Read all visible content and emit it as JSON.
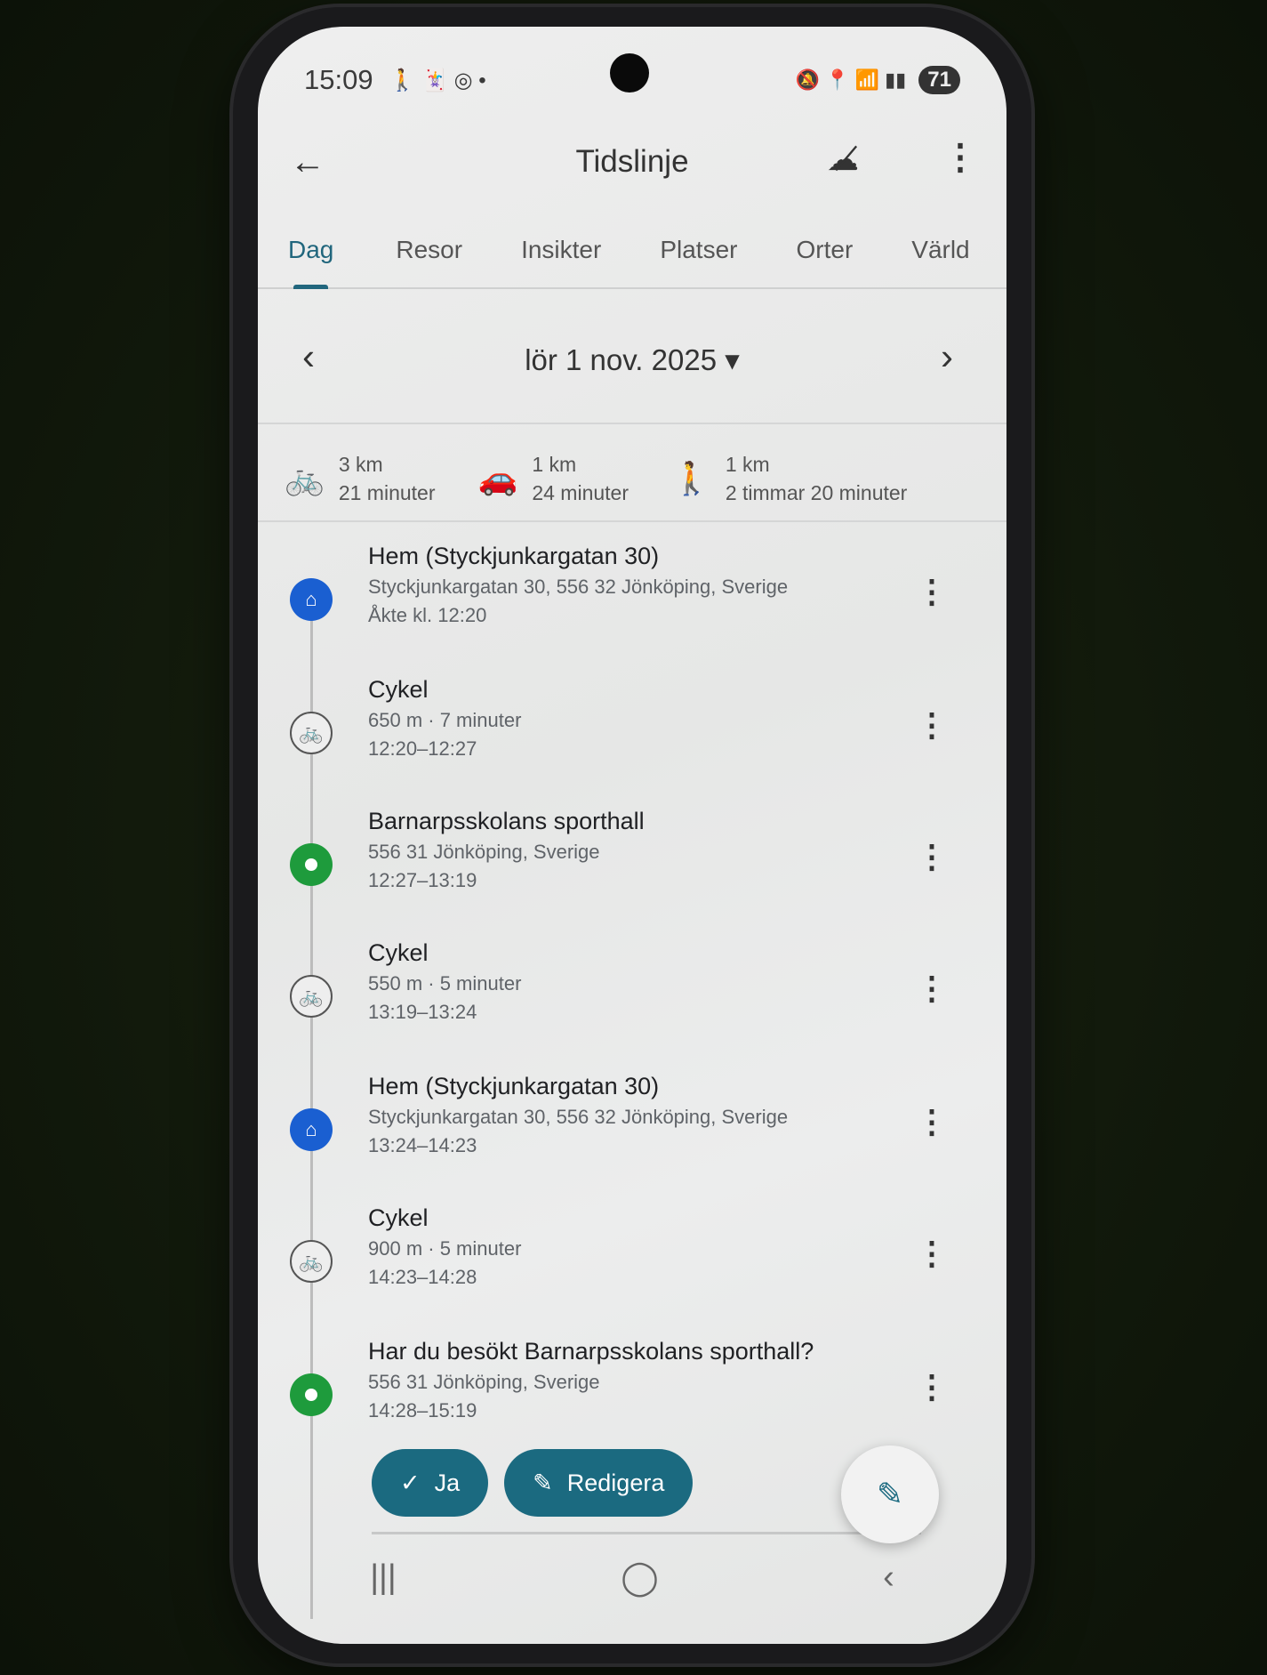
{
  "status": {
    "time": "15:09",
    "left_icons": "🚶 🃏 ◎ •",
    "right_icons": "🔕 📍 📶 ▮▮",
    "battery": "71"
  },
  "appbar": {
    "back_icon": "←",
    "title": "Tidslinje",
    "cloud_icon": "☁̸",
    "menu_icon": "⋮"
  },
  "tabs": [
    "Dag",
    "Resor",
    "Insikter",
    "Platser",
    "Orter",
    "Värld"
  ],
  "date_nav": {
    "prev": "‹",
    "date": "lör 1 nov. 2025 ▾",
    "next": "›"
  },
  "summary": [
    {
      "icon": "bike-icon",
      "glyph": "🚲",
      "distance": "3 km",
      "duration": "21 minuter"
    },
    {
      "icon": "car-icon",
      "glyph": "🚗",
      "distance": "1 km",
      "duration": "24 minuter"
    },
    {
      "icon": "walk-icon",
      "glyph": "🚶",
      "distance": "1 km",
      "duration": "2 timmar 20 minuter"
    }
  ],
  "entries": [
    {
      "type": "home",
      "title": "Hem (Styckjunkargatan 30)",
      "line1": "Styckjunkargatan 30, 556 32 Jönköping, Sverige",
      "line2": "Åkte kl. 12:20"
    },
    {
      "type": "bike",
      "title": "Cykel",
      "line1": "650 m · 7 minuter",
      "line2": "12:20–12:27"
    },
    {
      "type": "place",
      "title": "Barnarpsskolans sporthall",
      "line1": "556 31 Jönköping, Sverige",
      "line2": "12:27–13:19"
    },
    {
      "type": "bike",
      "title": "Cykel",
      "line1": "550 m · 5 minuter",
      "line2": "13:19–13:24"
    },
    {
      "type": "home",
      "title": "Hem (Styckjunkargatan 30)",
      "line1": "Styckjunkargatan 30, 556 32 Jönköping, Sverige",
      "line2": "13:24–14:23"
    },
    {
      "type": "bike",
      "title": "Cykel",
      "line1": "900 m · 5 minuter",
      "line2": "14:23–14:28"
    },
    {
      "type": "place",
      "title": "Har du besökt Barnarpsskolans sporthall?",
      "line1": "556 31 Jönköping, Sverige",
      "line2": "14:28–15:19"
    }
  ],
  "actions": {
    "yes_icon": "✓",
    "yes": "Ja",
    "edit_icon": "✎",
    "edit": "Redigera",
    "fab_icon": "✎"
  },
  "navbar": {
    "recents": "|||",
    "home": "◯",
    "back": "‹"
  },
  "colors": {
    "accent": "#1b6a80",
    "tab_active": "#21667d",
    "home_marker": "#1a5fd1",
    "place_marker": "#1e9b3c"
  }
}
